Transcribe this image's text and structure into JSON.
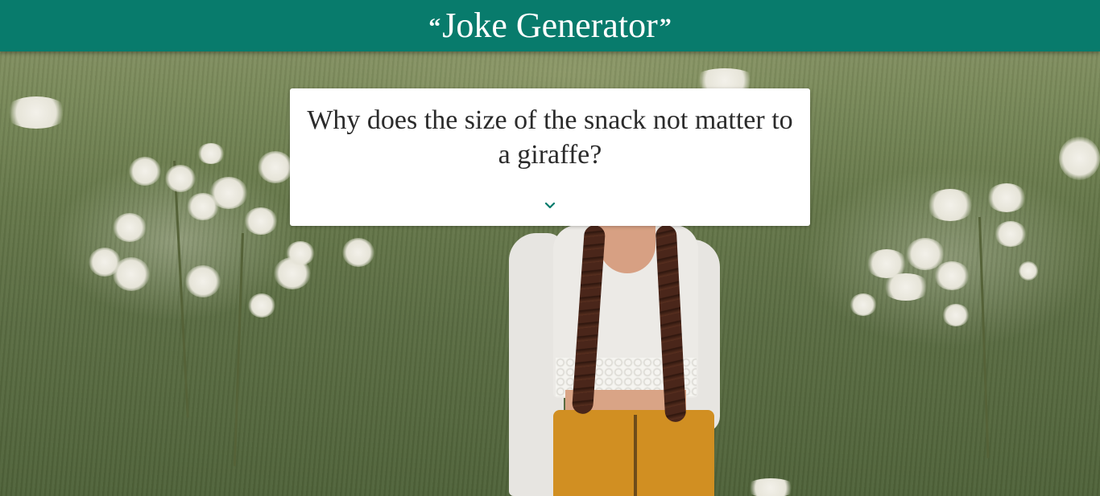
{
  "header": {
    "title": "Joke Generator",
    "open_quote_icon": "quote-open-icon",
    "close_quote_icon": "quote-close-icon",
    "background_color": "#087b6c"
  },
  "joke": {
    "question": "Why does the size of the snack not matter to a giraffe?",
    "reveal_icon": "chevron-down-icon",
    "reveal_icon_color": "#087b6c"
  }
}
